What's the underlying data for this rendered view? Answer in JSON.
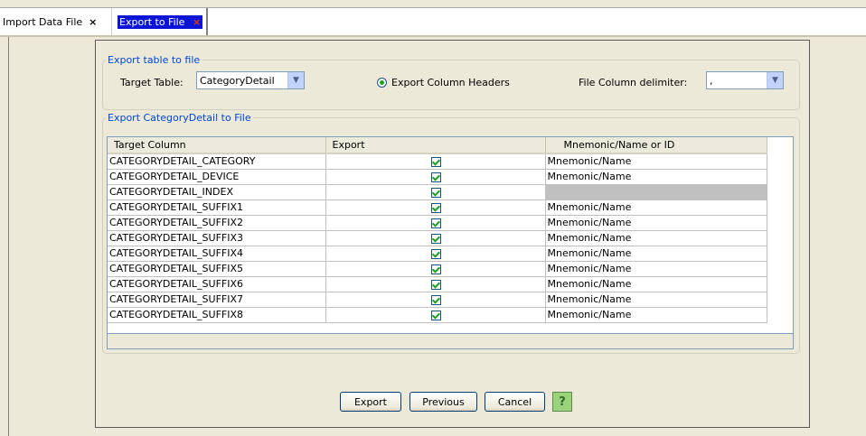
{
  "tabs": [
    {
      "label": "Import Data File",
      "close": "×"
    },
    {
      "label": "Export to File",
      "close": "×"
    }
  ],
  "export_group": {
    "legend": "Export table to file",
    "target_table_label": "Target Table:",
    "target_table_value": "CategoryDetail",
    "export_headers_label": "Export Column Headers",
    "delimiter_label": "File Column delimiter:",
    "delimiter_value": ","
  },
  "table_group": {
    "legend": "Export CategoryDetail to File",
    "columns": [
      "Target Column",
      "Export",
      "Mnemonic/Name or ID"
    ],
    "rows": [
      {
        "column": "CATEGORYDETAIL_CATEGORY",
        "export": true,
        "mnemonic": "Mnemonic/Name"
      },
      {
        "column": "CATEGORYDETAIL_DEVICE",
        "export": true,
        "mnemonic": "Mnemonic/Name"
      },
      {
        "column": "CATEGORYDETAIL_INDEX",
        "export": true,
        "mnemonic": ""
      },
      {
        "column": "CATEGORYDETAIL_SUFFIX1",
        "export": true,
        "mnemonic": "Mnemonic/Name"
      },
      {
        "column": "CATEGORYDETAIL_SUFFIX2",
        "export": true,
        "mnemonic": "Mnemonic/Name"
      },
      {
        "column": "CATEGORYDETAIL_SUFFIX3",
        "export": true,
        "mnemonic": "Mnemonic/Name"
      },
      {
        "column": "CATEGORYDETAIL_SUFFIX4",
        "export": true,
        "mnemonic": "Mnemonic/Name"
      },
      {
        "column": "CATEGORYDETAIL_SUFFIX5",
        "export": true,
        "mnemonic": "Mnemonic/Name"
      },
      {
        "column": "CATEGORYDETAIL_SUFFIX6",
        "export": true,
        "mnemonic": "Mnemonic/Name"
      },
      {
        "column": "CATEGORYDETAIL_SUFFIX7",
        "export": true,
        "mnemonic": "Mnemonic/Name"
      },
      {
        "column": "CATEGORYDETAIL_SUFFIX8",
        "export": true,
        "mnemonic": "Mnemonic/Name"
      }
    ]
  },
  "buttons": {
    "export": "Export",
    "previous": "Previous",
    "cancel": "Cancel",
    "help_icon": "help-icon"
  },
  "colors": {
    "legend": "#0046d5",
    "active_tab": "#0a14d6",
    "check": "#21a121"
  }
}
